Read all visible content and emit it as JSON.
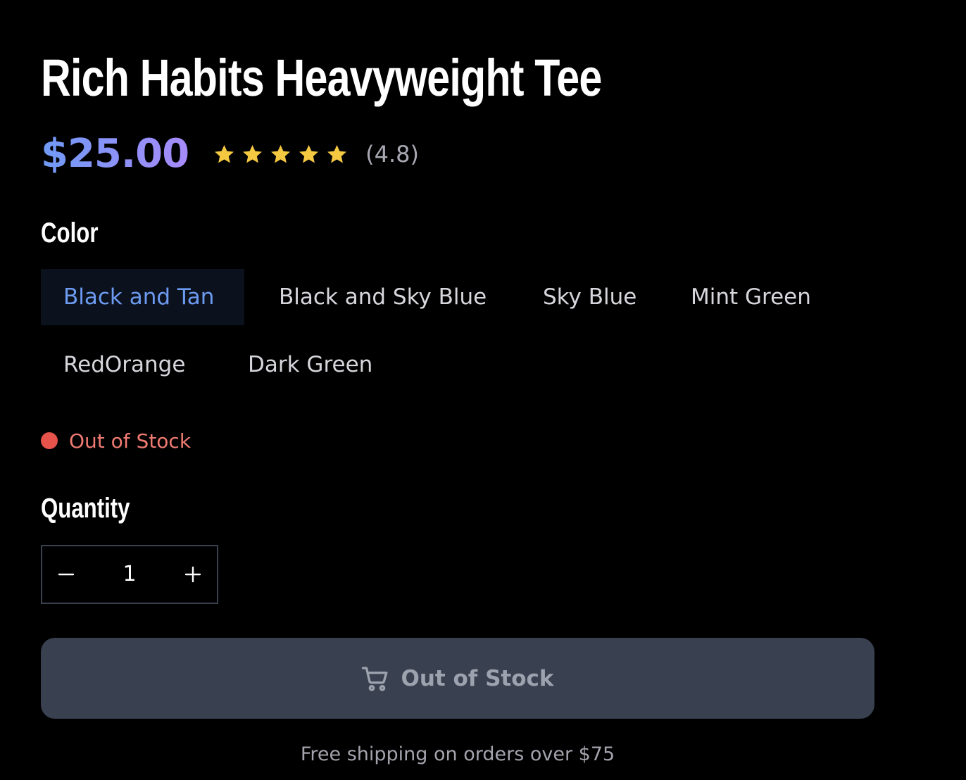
{
  "product": {
    "title": "Rich Habits Heavyweight Tee",
    "price": "$25.00",
    "rating": {
      "stars": 5,
      "value": 4.8,
      "label": "(4.8)"
    }
  },
  "color": {
    "label": "Color",
    "selected": "Black and Tan",
    "options": [
      "Black and Tan",
      "Black and Sky Blue",
      "Sky Blue",
      "Mint Green",
      "RedOrange",
      "Dark Green"
    ]
  },
  "stock": {
    "status": "Out of Stock",
    "dot_color": "#e5534b"
  },
  "quantity": {
    "label": "Quantity",
    "value": "1",
    "decrement_icon": "minus-icon",
    "increment_icon": "plus-icon"
  },
  "cta": {
    "label": "Out of Stock",
    "icon": "cart-icon",
    "disabled": true
  },
  "shipping_note": "Free shipping on orders over $75",
  "colors": {
    "background": "#000000",
    "accent_blue": "#6d9bf1",
    "accent_purple": "#a78bfa",
    "star": "#f5c842",
    "button_bg": "#394150"
  }
}
